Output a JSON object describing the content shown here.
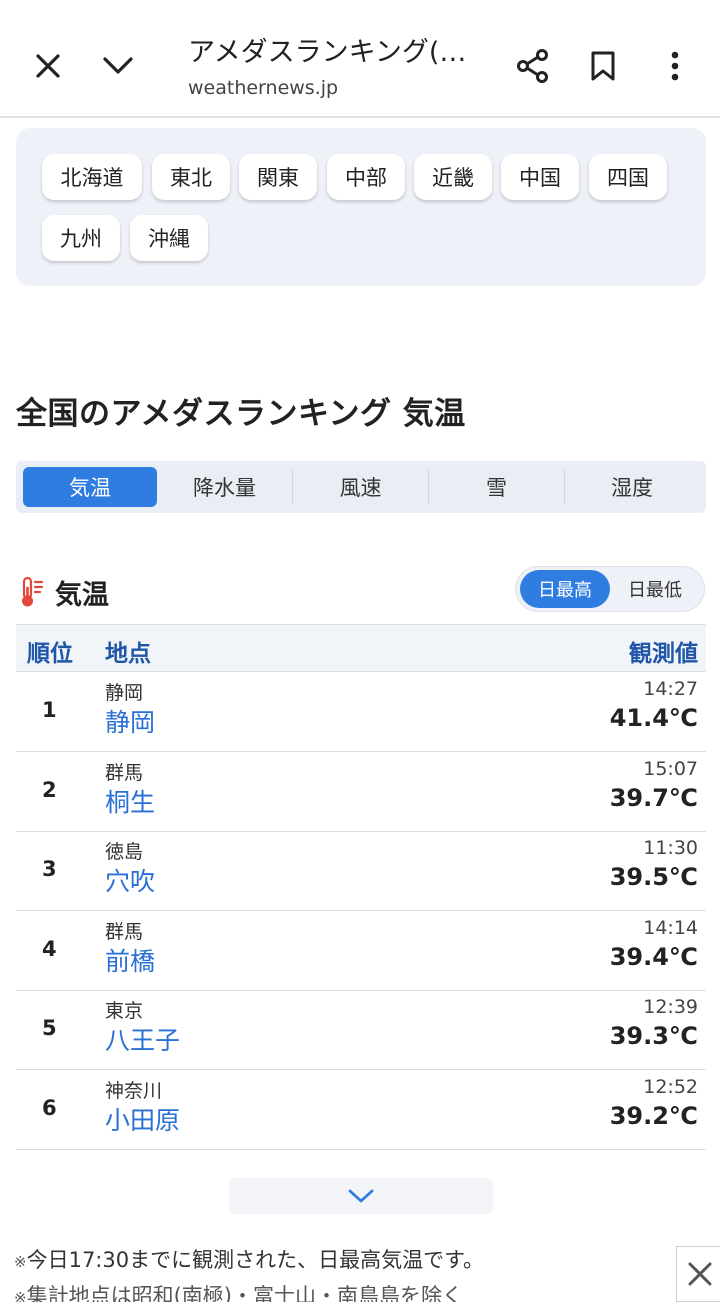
{
  "browser": {
    "title": "アメダスランキング(…",
    "url": "weathernews.jp"
  },
  "regions": [
    "北海道",
    "東北",
    "関東",
    "中部",
    "近畿",
    "中国",
    "四国",
    "九州",
    "沖縄"
  ],
  "section_title": "全国のアメダスランキング 気温",
  "tabs": [
    {
      "label": "気温",
      "active": true
    },
    {
      "label": "降水量",
      "active": false
    },
    {
      "label": "風速",
      "active": false
    },
    {
      "label": "雪",
      "active": false
    },
    {
      "label": "湿度",
      "active": false
    }
  ],
  "ranking": {
    "title": "気温",
    "toggle": [
      {
        "label": "日最高",
        "active": true
      },
      {
        "label": "日最低",
        "active": false
      }
    ],
    "columns": {
      "rank": "順位",
      "location": "地点",
      "value": "観測値"
    },
    "rows": [
      {
        "rank": "1",
        "prefecture": "静岡",
        "station": "静岡",
        "time": "14:27",
        "value": "41.4℃"
      },
      {
        "rank": "2",
        "prefecture": "群馬",
        "station": "桐生",
        "time": "15:07",
        "value": "39.7℃"
      },
      {
        "rank": "3",
        "prefecture": "徳島",
        "station": "穴吹",
        "time": "11:30",
        "value": "39.5℃"
      },
      {
        "rank": "4",
        "prefecture": "群馬",
        "station": "前橋",
        "time": "14:14",
        "value": "39.4℃"
      },
      {
        "rank": "5",
        "prefecture": "東京",
        "station": "八王子",
        "time": "12:39",
        "value": "39.3℃"
      },
      {
        "rank": "6",
        "prefecture": "神奈川",
        "station": "小田原",
        "time": "12:52",
        "value": "39.2℃"
      }
    ]
  },
  "notes": {
    "mark": "※",
    "note1": "今日17:30までに観測された、日最高気温です。",
    "note2": "集計地点は昭和(南極)・富士山・南鳥島を除く"
  },
  "colors": {
    "accent": "#2f7de1",
    "link": "#2a6fd6",
    "header_text": "#1f56a8"
  }
}
